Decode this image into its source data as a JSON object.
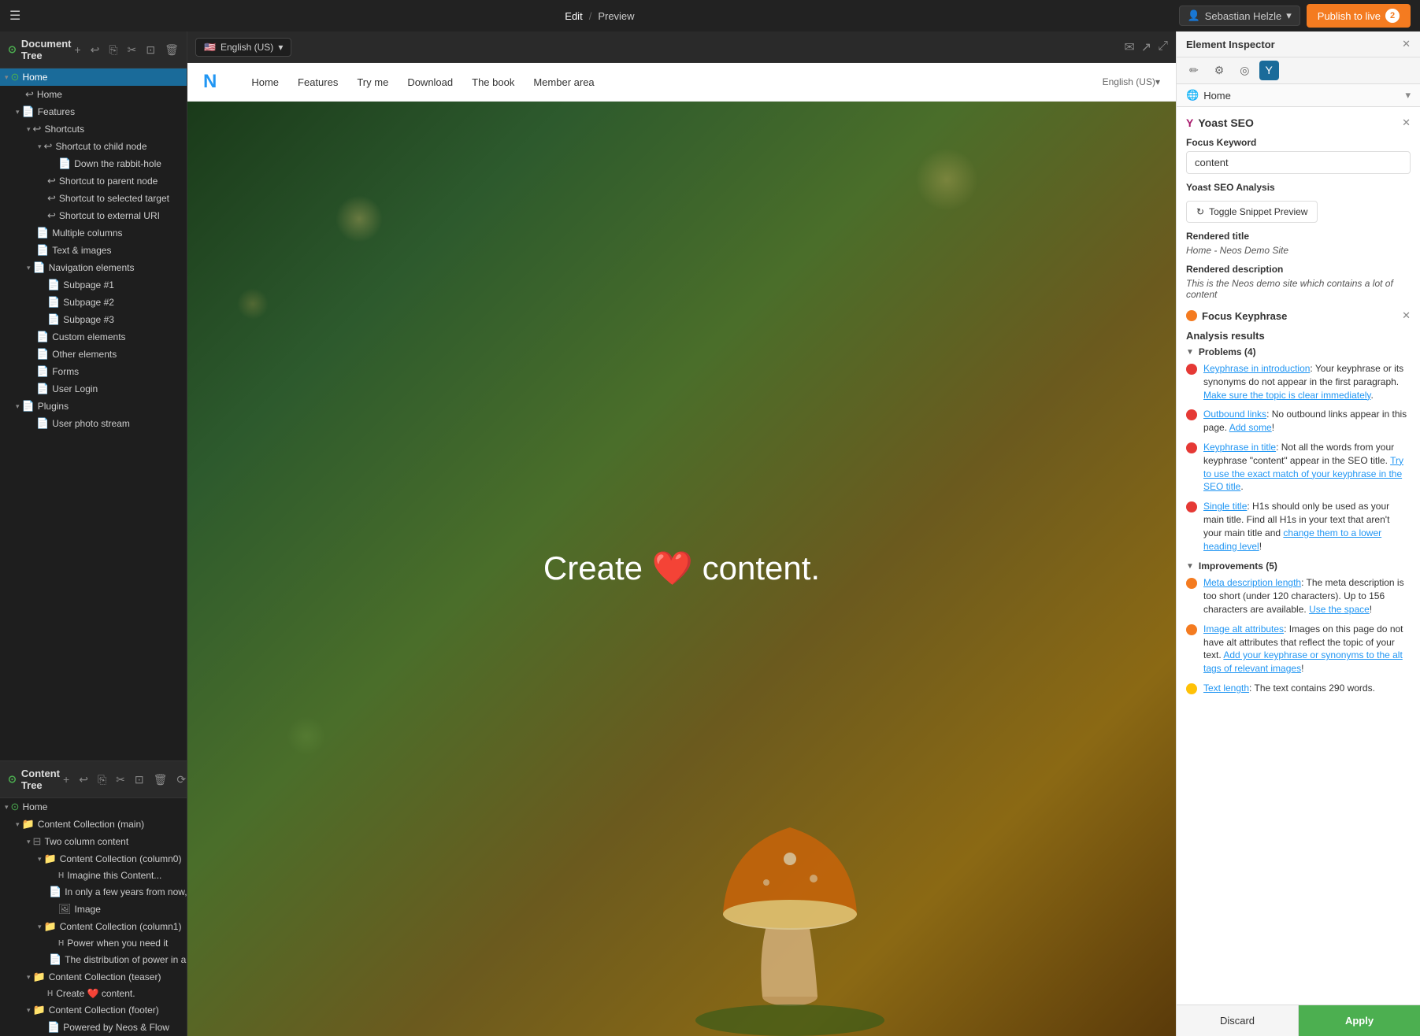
{
  "topbar": {
    "menu_icon": "☰",
    "edit_label": "Edit",
    "slash": "/",
    "preview_label": "Preview",
    "user_icon": "👤",
    "user_name": "Sebastian Helzle",
    "publish_label": "Publish to live",
    "publish_count": "2"
  },
  "document_tree": {
    "title": "Document Tree",
    "toolbar": {
      "add": "+",
      "undo": "↩",
      "copy": "⎘",
      "cut": "✂",
      "paste": "⊡",
      "delete": "🗑",
      "refresh": "⟳",
      "more": "⋯"
    },
    "nodes": [
      {
        "id": "home",
        "label": "Home",
        "indent": 0,
        "icon": "🏠",
        "toggle": "▼",
        "active": true
      },
      {
        "id": "home-child",
        "label": "Home",
        "indent": 1,
        "icon": "↩",
        "toggle": ""
      },
      {
        "id": "features",
        "label": "Features",
        "indent": 1,
        "icon": "📄",
        "toggle": "▼"
      },
      {
        "id": "shortcuts",
        "label": "Shortcuts",
        "indent": 2,
        "icon": "↩",
        "toggle": "▼"
      },
      {
        "id": "shortcut-child",
        "label": "Shortcut to child node",
        "indent": 3,
        "icon": "↩",
        "toggle": "▼"
      },
      {
        "id": "down-rabbit",
        "label": "Down the rabbit-hole",
        "indent": 4,
        "icon": "📄",
        "toggle": ""
      },
      {
        "id": "shortcut-parent",
        "label": "Shortcut to parent node",
        "indent": 3,
        "icon": "↩",
        "toggle": ""
      },
      {
        "id": "shortcut-selected",
        "label": "Shortcut to selected target",
        "indent": 3,
        "icon": "↩",
        "toggle": ""
      },
      {
        "id": "shortcut-external",
        "label": "Shortcut to external URI",
        "indent": 3,
        "icon": "↩",
        "toggle": ""
      },
      {
        "id": "multiple-cols",
        "label": "Multiple columns",
        "indent": 2,
        "icon": "📄",
        "toggle": ""
      },
      {
        "id": "text-images",
        "label": "Text & images",
        "indent": 2,
        "icon": "📄",
        "toggle": ""
      },
      {
        "id": "nav-elements",
        "label": "Navigation elements",
        "indent": 2,
        "icon": "📄",
        "toggle": "▼"
      },
      {
        "id": "subpage1",
        "label": "Subpage #1",
        "indent": 3,
        "icon": "📄",
        "toggle": ""
      },
      {
        "id": "subpage2",
        "label": "Subpage #2",
        "indent": 3,
        "icon": "📄",
        "toggle": ""
      },
      {
        "id": "subpage3",
        "label": "Subpage #3",
        "indent": 3,
        "icon": "📄",
        "toggle": ""
      },
      {
        "id": "custom-elements",
        "label": "Custom elements",
        "indent": 2,
        "icon": "📄",
        "toggle": ""
      },
      {
        "id": "other-elements",
        "label": "Other elements",
        "indent": 2,
        "icon": "📄",
        "toggle": ""
      },
      {
        "id": "forms",
        "label": "Forms",
        "indent": 2,
        "icon": "📄",
        "toggle": ""
      },
      {
        "id": "user-login",
        "label": "User Login",
        "indent": 2,
        "icon": "📄",
        "toggle": ""
      },
      {
        "id": "plugins",
        "label": "Plugins",
        "indent": 1,
        "icon": "📄",
        "toggle": "▼"
      },
      {
        "id": "user-photo",
        "label": "User photo stream",
        "indent": 2,
        "icon": "📄",
        "toggle": ""
      }
    ]
  },
  "content_tree": {
    "title": "Content Tree",
    "toolbar": {
      "add": "+",
      "undo": "↩",
      "copy": "⎘",
      "cut": "✂",
      "paste": "⊡",
      "delete": "🗑",
      "refresh": "⟳"
    },
    "nodes": [
      {
        "id": "ct-home",
        "label": "Home",
        "indent": 0,
        "icon": "🏠",
        "toggle": "▼"
      },
      {
        "id": "ct-content-main",
        "label": "Content Collection (main)",
        "indent": 1,
        "icon": "📁",
        "toggle": "▼"
      },
      {
        "id": "ct-two-col",
        "label": "Two column content",
        "indent": 2,
        "icon": "⊟",
        "toggle": "▼"
      },
      {
        "id": "ct-col0",
        "label": "Content Collection (column0)",
        "indent": 3,
        "icon": "📁",
        "toggle": "▼"
      },
      {
        "id": "ct-imagine",
        "label": "Imagine this Content...",
        "indent": 4,
        "icon": "H",
        "toggle": ""
      },
      {
        "id": "ct-infew",
        "label": "In only a few years from now,",
        "indent": 4,
        "icon": "📄",
        "toggle": ""
      },
      {
        "id": "ct-image",
        "label": "Image",
        "indent": 4,
        "icon": "🖼",
        "toggle": ""
      },
      {
        "id": "ct-col1",
        "label": "Content Collection (column1)",
        "indent": 3,
        "icon": "📁",
        "toggle": "▼"
      },
      {
        "id": "ct-power",
        "label": "Power when you need it",
        "indent": 4,
        "icon": "H",
        "toggle": ""
      },
      {
        "id": "ct-distribution",
        "label": "The distribution of power in a",
        "indent": 4,
        "icon": "📄",
        "toggle": ""
      },
      {
        "id": "ct-teaser",
        "label": "Content Collection (teaser)",
        "indent": 2,
        "icon": "📁",
        "toggle": "▼"
      },
      {
        "id": "ct-create",
        "label": "Create ❤️ content.",
        "indent": 3,
        "icon": "H",
        "toggle": ""
      },
      {
        "id": "ct-footer",
        "label": "Content Collection (footer)",
        "indent": 2,
        "icon": "📁",
        "toggle": "▼"
      },
      {
        "id": "ct-powered",
        "label": "Powered by Neos & Flow",
        "indent": 3,
        "icon": "📄",
        "toggle": ""
      }
    ]
  },
  "preview": {
    "lang_flag": "🇺🇸",
    "lang_label": "English (US)",
    "nav_items": [
      "Home",
      "Features",
      "Try me",
      "Download",
      "The book",
      "Member area"
    ],
    "lang_right": "English (US)▾",
    "hero_text_1": "Create",
    "hero_heart": "❤️",
    "hero_text_2": "content."
  },
  "inspector": {
    "title": "Element Inspector",
    "tabs": [
      {
        "id": "pencil",
        "icon": "✏️"
      },
      {
        "id": "gear",
        "icon": "⚙️"
      },
      {
        "id": "target",
        "icon": "🎯"
      },
      {
        "id": "yoast",
        "icon": "Y",
        "active": true
      }
    ],
    "node_selector": "Home",
    "yoast_title": "Yoast SEO",
    "focus_keyword_label": "Focus Keyword",
    "focus_keyword_value": "content",
    "yoast_analysis_label": "Yoast SEO Analysis",
    "toggle_snippet_label": "Toggle Snippet Preview",
    "rendered_title_label": "Rendered title",
    "rendered_title_value": "Home - Neos Demo Site",
    "rendered_desc_label": "Rendered description",
    "rendered_desc_value": "This is the Neos demo site which contains a lot of content",
    "focus_keyphrase_label": "Focus Keyphrase",
    "analysis_results_label": "Analysis results",
    "problems_label": "Problems (4)",
    "problems": [
      {
        "type": "red",
        "text_before": "Keyphrase in introduction",
        "text_after": ": Your keyphrase or its synonyms do not appear in the first paragraph. ",
        "link_text": "Make sure the topic is clear immediately",
        "text_end": "."
      },
      {
        "type": "red",
        "text_before": "Outbound links",
        "text_after": ": No outbound links appear in this page. ",
        "link_text": "Add some",
        "text_end": "!"
      },
      {
        "type": "red",
        "text_before": "Keyphrase in title",
        "text_after": ": Not all the words from your keyphrase \"content\" appear in the SEO title. ",
        "link_text": "Try to use the exact match of your keyphrase in the SEO title",
        "text_end": "."
      },
      {
        "type": "red",
        "text_before": "Single title",
        "text_after": ": H1s should only be used as your main title. Find all H1s in your text that aren't your main title and ",
        "link_text": "change them to a lower heading level",
        "text_end": "!"
      }
    ],
    "improvements_label": "Improvements (5)",
    "improvements": [
      {
        "type": "orange",
        "text_before": "Meta description length",
        "text_after": ": The meta description is too short (under 120 characters). Up to 156 characters are available. ",
        "link_text": "Use the space",
        "text_end": "!"
      },
      {
        "type": "orange",
        "text_before": "Image alt attributes",
        "text_after": ": Images on this page do not have alt attributes that reflect the topic of your text. ",
        "link_text": "Add your keyphrase or synonyms to the alt tags of relevant images",
        "text_end": "!"
      },
      {
        "type": "yellow",
        "text_before": "Text length",
        "text_after": ": The text contains 290 words.",
        "link_text": "",
        "text_end": ""
      }
    ],
    "discard_label": "Discard",
    "apply_label": "Apply"
  }
}
